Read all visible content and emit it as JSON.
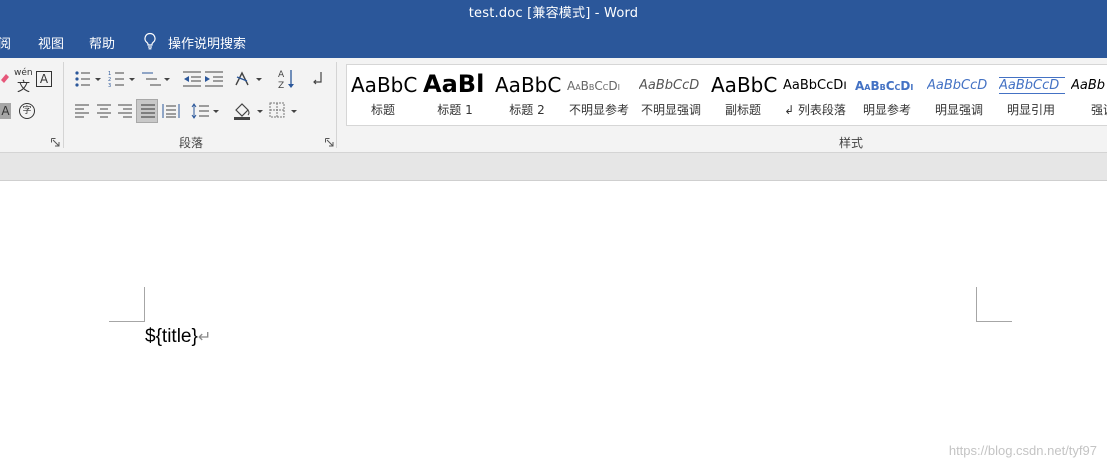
{
  "window": {
    "title": "test.doc [兼容模式]  -  Word"
  },
  "menu": {
    "items": [
      "阅",
      "视图",
      "帮助"
    ],
    "tell_me": "操作说明搜索"
  },
  "ribbon": {
    "font_group": {
      "phonetic_guide_glyph": "wén",
      "phonetic_guide_char": "文",
      "char_border_glyph": "A",
      "char_shading_glyph": "A",
      "enclose_char_glyph": "字"
    },
    "paragraph_group": {
      "label": "段落"
    },
    "styles_group": {
      "label": "样式",
      "styles": [
        {
          "sample": "AaBbC",
          "name": "标题"
        },
        {
          "sample": "AaBl",
          "name": "标题 1"
        },
        {
          "sample": "AaBbC",
          "name": "标题 2"
        },
        {
          "sample": "AaBbCcDı",
          "name": "不明显参考"
        },
        {
          "sample": "AaBbCcD",
          "name": "不明显强调"
        },
        {
          "sample": "AaBbC",
          "name": "副标题"
        },
        {
          "sample": "AaBbCcDı",
          "name": "↲ 列表段落"
        },
        {
          "sample": "AaBbCcDı",
          "name": "明显参考"
        },
        {
          "sample": "AaBbCcD",
          "name": "明显强调"
        },
        {
          "sample": "AaBbCcD",
          "name": "明显引用"
        },
        {
          "sample": "AaBb",
          "name": "强调"
        }
      ]
    }
  },
  "document": {
    "text": "${title}",
    "paragraph_mark": "↵"
  },
  "watermark": "https://blog.csdn.net/tyf97",
  "colors": {
    "title_bar": "#2b579a",
    "ribbon_bg": "#f3f3f3",
    "accent_blue": "#4472c4"
  }
}
